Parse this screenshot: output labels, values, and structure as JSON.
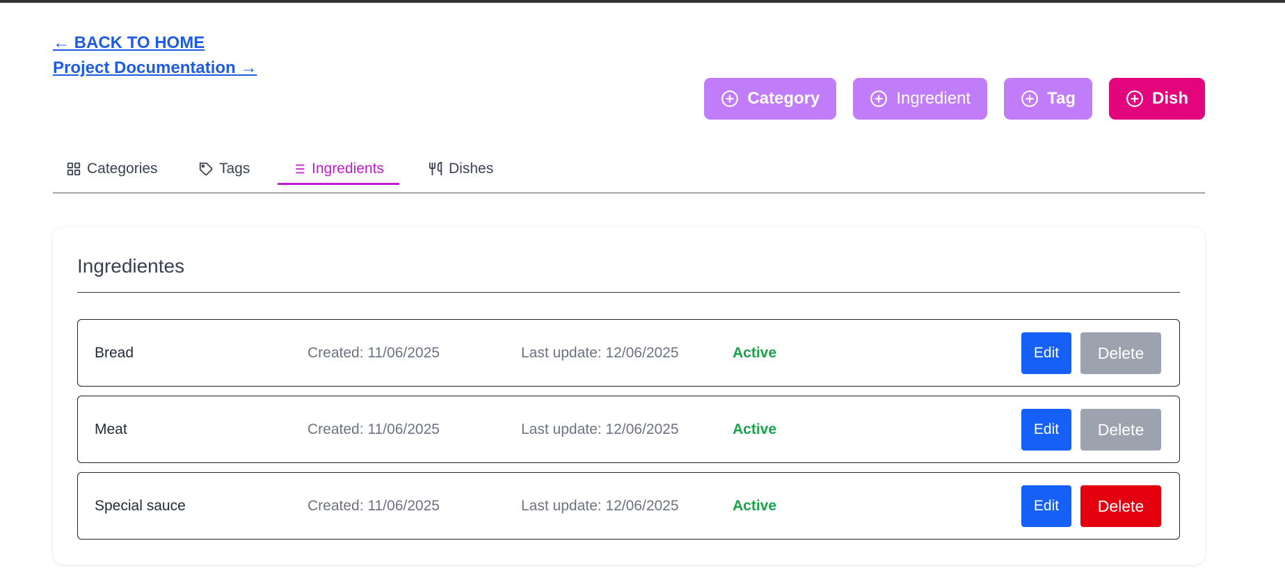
{
  "nav": {
    "back_home": "← BACK TO HOME",
    "project_docs": "Project Documentation →"
  },
  "actions": [
    {
      "label": "Category",
      "bold": true,
      "color": "#c17cfa"
    },
    {
      "label": "Ingredient",
      "bold": false,
      "color": "#c17cfa"
    },
    {
      "label": "Tag",
      "bold": true,
      "color": "#c17cfa"
    },
    {
      "label": "Dish",
      "bold": true,
      "color": "#e2057b"
    }
  ],
  "tabs": [
    {
      "label": "Categories",
      "icon": "grid-icon",
      "active": false
    },
    {
      "label": "Tags",
      "icon": "tag-icon",
      "active": false
    },
    {
      "label": "Ingredients",
      "icon": "list-icon",
      "active": true
    },
    {
      "label": "Dishes",
      "icon": "utensils-icon",
      "active": false
    }
  ],
  "card": {
    "title": "Ingredientes",
    "rows": [
      {
        "name": "Bread",
        "created": "Created: 11/06/2025",
        "updated": "Last update: 12/06/2025",
        "status": "Active",
        "edit": "Edit",
        "delete": "Delete",
        "delete_color": "#9ca3af"
      },
      {
        "name": "Meat",
        "created": "Created: 11/06/2025",
        "updated": "Last update: 12/06/2025",
        "status": "Active",
        "edit": "Edit",
        "delete": "Delete",
        "delete_color": "#9ca3af"
      },
      {
        "name": "Special sauce",
        "created": "Created: 11/06/2025",
        "updated": "Last update: 12/06/2025",
        "status": "Active",
        "edit": "Edit",
        "delete": "Delete",
        "delete_color": "#e5000f"
      }
    ]
  },
  "colors": {
    "link": "#1d5be6",
    "active_tab": "#c11ad1",
    "status_active": "#16a34a",
    "edit_button": "#1660f7"
  }
}
